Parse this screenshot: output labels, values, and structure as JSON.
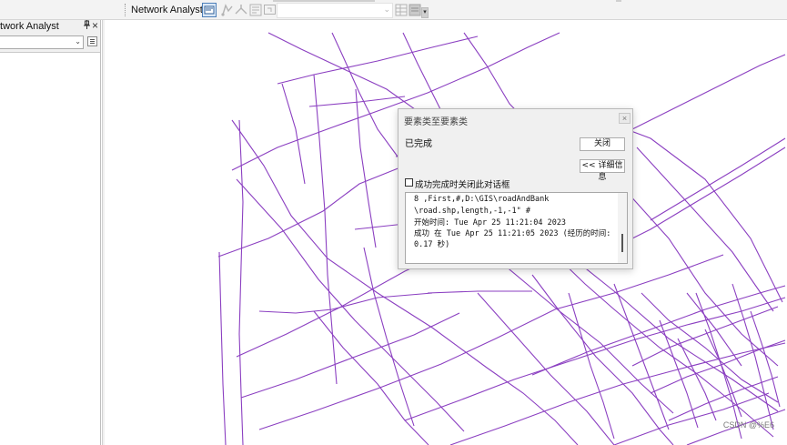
{
  "toolbar": {
    "network_analyst_label": "Network Analyst",
    "network_analyst_caret": "▾",
    "combo_value": "",
    "combo_arrow": "⌄",
    "more_glyph": "▾",
    "icons": [
      "network-analyst-window-icon",
      "new-route-icon",
      "direction-icon",
      "solve-icon",
      "properties-icon",
      "build-network-icon",
      "attributes-icon"
    ]
  },
  "dock": {
    "title": "Network Analyst",
    "pin": "ᵠ",
    "close": "×",
    "select_value": "",
    "select_arrow": "⌄"
  },
  "dialog": {
    "title": "要素类至要素类",
    "close_glyph": "×",
    "status": "已完成",
    "close_button": "关闭",
    "details_button": "<< 详细信息",
    "checkbox_label": "成功完成时关闭此对话框",
    "checkbox_checked": false,
    "log_lines": [
      "8 ,First,#,D:\\GIS\\roadAndBank",
      "\\road.shp,length,-1,-1\" #",
      "开始时间: Tue Apr 25 11:21:04 2023",
      "成功 在 Tue Apr 25 11:21:05 2023 (经历的时间:",
      "0.17 秒)"
    ]
  },
  "map": {
    "road_color": "#8b3fc1"
  },
  "watermark": "CSDN @%E6"
}
